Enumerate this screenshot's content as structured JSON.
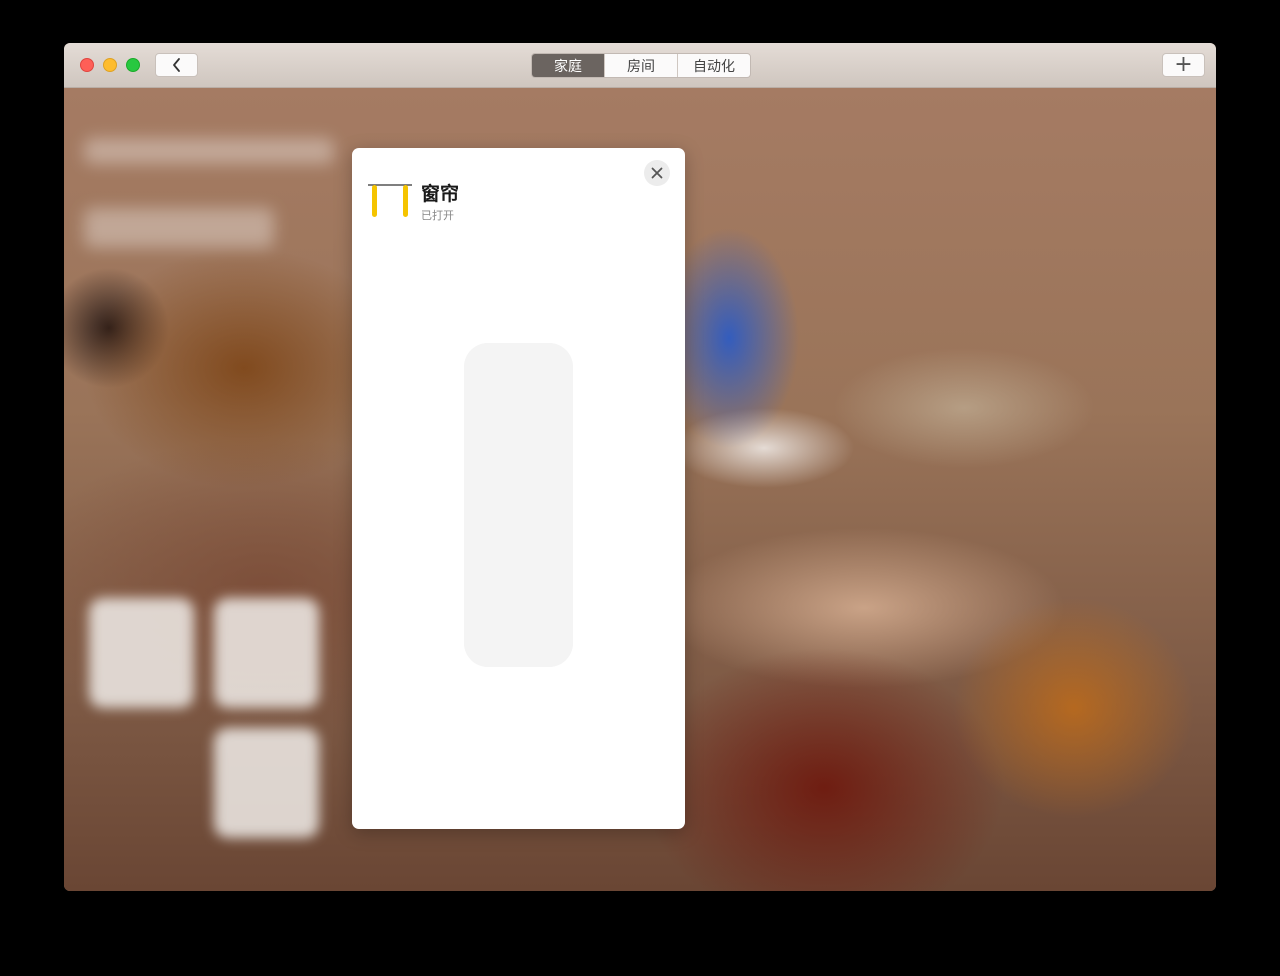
{
  "toolbar": {
    "tabs": [
      {
        "label": "家庭",
        "active": true
      },
      {
        "label": "房间",
        "active": false
      },
      {
        "label": "自动化",
        "active": false
      }
    ],
    "back_icon": "chevron-left-icon",
    "add_label": "+"
  },
  "modal": {
    "accessory_name": "窗帘",
    "status": "已打开",
    "icon": "curtain-icon",
    "accent_color": "#f5c400",
    "slider": {
      "label": "",
      "open_fraction": 1.0
    }
  }
}
